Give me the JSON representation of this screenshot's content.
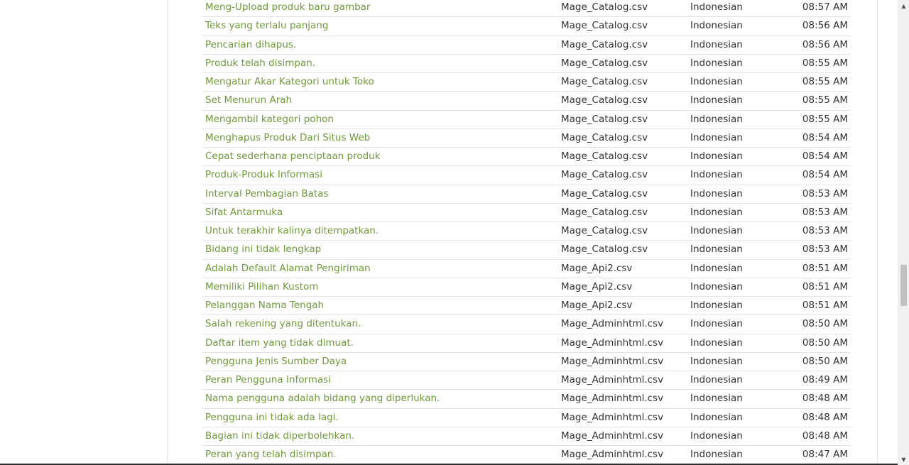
{
  "table": {
    "rows": [
      {
        "text": "Meng-Upload produk baru gambar",
        "file": "Mage_Catalog.csv",
        "language": "Indonesian",
        "time": "08:57 AM"
      },
      {
        "text": "Teks yang terlalu panjang",
        "file": "Mage_Catalog.csv",
        "language": "Indonesian",
        "time": "08:56 AM"
      },
      {
        "text": "Pencarian dihapus.",
        "file": "Mage_Catalog.csv",
        "language": "Indonesian",
        "time": "08:56 AM"
      },
      {
        "text": "Produk telah disimpan.",
        "file": "Mage_Catalog.csv",
        "language": "Indonesian",
        "time": "08:55 AM"
      },
      {
        "text": "Mengatur Akar Kategori untuk Toko",
        "file": "Mage_Catalog.csv",
        "language": "Indonesian",
        "time": "08:55 AM"
      },
      {
        "text": "Set Menurun Arah",
        "file": "Mage_Catalog.csv",
        "language": "Indonesian",
        "time": "08:55 AM"
      },
      {
        "text": "Mengambil kategori pohon",
        "file": "Mage_Catalog.csv",
        "language": "Indonesian",
        "time": "08:55 AM"
      },
      {
        "text": "Menghapus Produk Dari Situs Web",
        "file": "Mage_Catalog.csv",
        "language": "Indonesian",
        "time": "08:54 AM"
      },
      {
        "text": "Cepat sederhana penciptaan produk",
        "file": "Mage_Catalog.csv",
        "language": "Indonesian",
        "time": "08:54 AM"
      },
      {
        "text": "Produk-Produk Informasi",
        "file": "Mage_Catalog.csv",
        "language": "Indonesian",
        "time": "08:54 AM"
      },
      {
        "text": "Interval Pembagian Batas",
        "file": "Mage_Catalog.csv",
        "language": "Indonesian",
        "time": "08:53 AM"
      },
      {
        "text": "Sifat Antarmuka",
        "file": "Mage_Catalog.csv",
        "language": "Indonesian",
        "time": "08:53 AM"
      },
      {
        "text": "Untuk terakhir kalinya ditempatkan.",
        "file": "Mage_Catalog.csv",
        "language": "Indonesian",
        "time": "08:53 AM"
      },
      {
        "text": "Bidang ini tidak lengkap",
        "file": "Mage_Catalog.csv",
        "language": "Indonesian",
        "time": "08:53 AM"
      },
      {
        "text": "Adalah Default Alamat Pengiriman",
        "file": "Mage_Api2.csv",
        "language": "Indonesian",
        "time": "08:51 AM"
      },
      {
        "text": "Memiliki Pilihan Kustom",
        "file": "Mage_Api2.csv",
        "language": "Indonesian",
        "time": "08:51 AM"
      },
      {
        "text": "Pelanggan Nama Tengah",
        "file": "Mage_Api2.csv",
        "language": "Indonesian",
        "time": "08:51 AM"
      },
      {
        "text": "Salah rekening yang ditentukan.",
        "file": "Mage_Adminhtml.csv",
        "language": "Indonesian",
        "time": "08:50 AM"
      },
      {
        "text": "Daftar item yang tidak dimuat.",
        "file": "Mage_Adminhtml.csv",
        "language": "Indonesian",
        "time": "08:50 AM"
      },
      {
        "text": "Pengguna Jenis Sumber Daya",
        "file": "Mage_Adminhtml.csv",
        "language": "Indonesian",
        "time": "08:50 AM"
      },
      {
        "text": "Peran Pengguna Informasi",
        "file": "Mage_Adminhtml.csv",
        "language": "Indonesian",
        "time": "08:49 AM"
      },
      {
        "text": "Nama pengguna adalah bidang yang diperlukan.",
        "file": "Mage_Adminhtml.csv",
        "language": "Indonesian",
        "time": "08:48 AM"
      },
      {
        "text": "Pengguna ini tidak ada lagi.",
        "file": "Mage_Adminhtml.csv",
        "language": "Indonesian",
        "time": "08:48 AM"
      },
      {
        "text": "Bagian ini tidak diperbolehkan.",
        "file": "Mage_Adminhtml.csv",
        "language": "Indonesian",
        "time": "08:48 AM"
      },
      {
        "text": "Peran yang telah disimpan.",
        "file": "Mage_Adminhtml.csv",
        "language": "Indonesian",
        "time": "08:47 AM"
      }
    ]
  },
  "scrollbar": {
    "up_icon": "scroll-up-arrow-icon",
    "down_icon": "scroll-down-arrow-icon",
    "up_glyph": "▲",
    "down_glyph": "▼"
  },
  "colors": {
    "link": "#6f9a3a",
    "text": "#333333",
    "divider": "#e3e3e3"
  }
}
